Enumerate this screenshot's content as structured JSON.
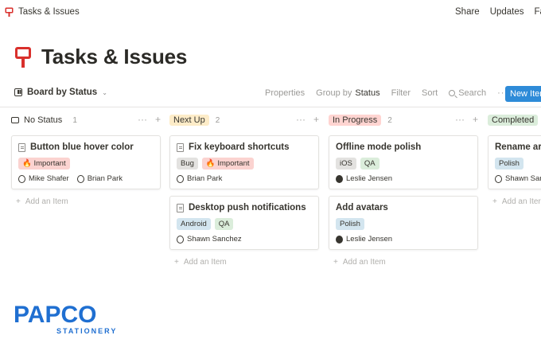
{
  "topbar": {
    "breadcrumb": "Tasks & Issues",
    "actions": [
      "Share",
      "Updates",
      "Fave"
    ]
  },
  "page": {
    "title": "Tasks & Issues",
    "icon": "pushpin-board-icon"
  },
  "viewbar": {
    "view_name": "Board by Status",
    "properties": "Properties",
    "group_by_label": "Group by",
    "group_by_value": "Status",
    "filter": "Filter",
    "sort": "Sort",
    "search": "Search",
    "more": "···",
    "new_button": "New Item"
  },
  "colors": {
    "accent": "#2e8bd8",
    "red_tag": "#fbd3d0",
    "gray_tag": "#e3e2e0",
    "blue_tag": "#d3e5ef",
    "green_tag": "#dbeddb",
    "next_up": "#fdecc8",
    "in_progress": "#ffd4d1",
    "completed": "#dbeddb"
  },
  "columns": [
    {
      "name": "No Status",
      "count": "1",
      "cards": [
        {
          "title": "Button blue hover color",
          "tags": [
            "🔥 Important"
          ],
          "people": [
            "Mike Shafer",
            "Brian Park"
          ]
        }
      ],
      "add_label": "Add an Item"
    },
    {
      "name": "Next Up",
      "count": "2",
      "cards": [
        {
          "title": "Fix keyboard shortcuts",
          "tags": [
            "Bug",
            "🔥 Important"
          ],
          "people": [
            "Brian Park"
          ]
        },
        {
          "title": "Desktop push notifications",
          "tags": [
            "Android",
            "QA"
          ],
          "people": [
            "Shawn Sanchez"
          ]
        }
      ],
      "add_label": "Add an Item"
    },
    {
      "name": "In Progress",
      "count": "2",
      "cards": [
        {
          "title": "Offline mode polish",
          "tags": [
            "iOS",
            "QA"
          ],
          "people": [
            "Leslie Jensen"
          ]
        },
        {
          "title": "Add avatars",
          "tags": [
            "Polish"
          ],
          "people": [
            "Leslie Jensen"
          ]
        }
      ],
      "add_label": "Add an Item"
    },
    {
      "name": "Completed",
      "count": "",
      "cards": [
        {
          "title": "Rename arch",
          "tags": [
            "Polish"
          ],
          "people": [
            "Shawn Sanc"
          ]
        }
      ],
      "add_label": "Add an Iter"
    }
  ],
  "logo": {
    "line1": "PAPCO",
    "line2": "STATIONERY"
  }
}
